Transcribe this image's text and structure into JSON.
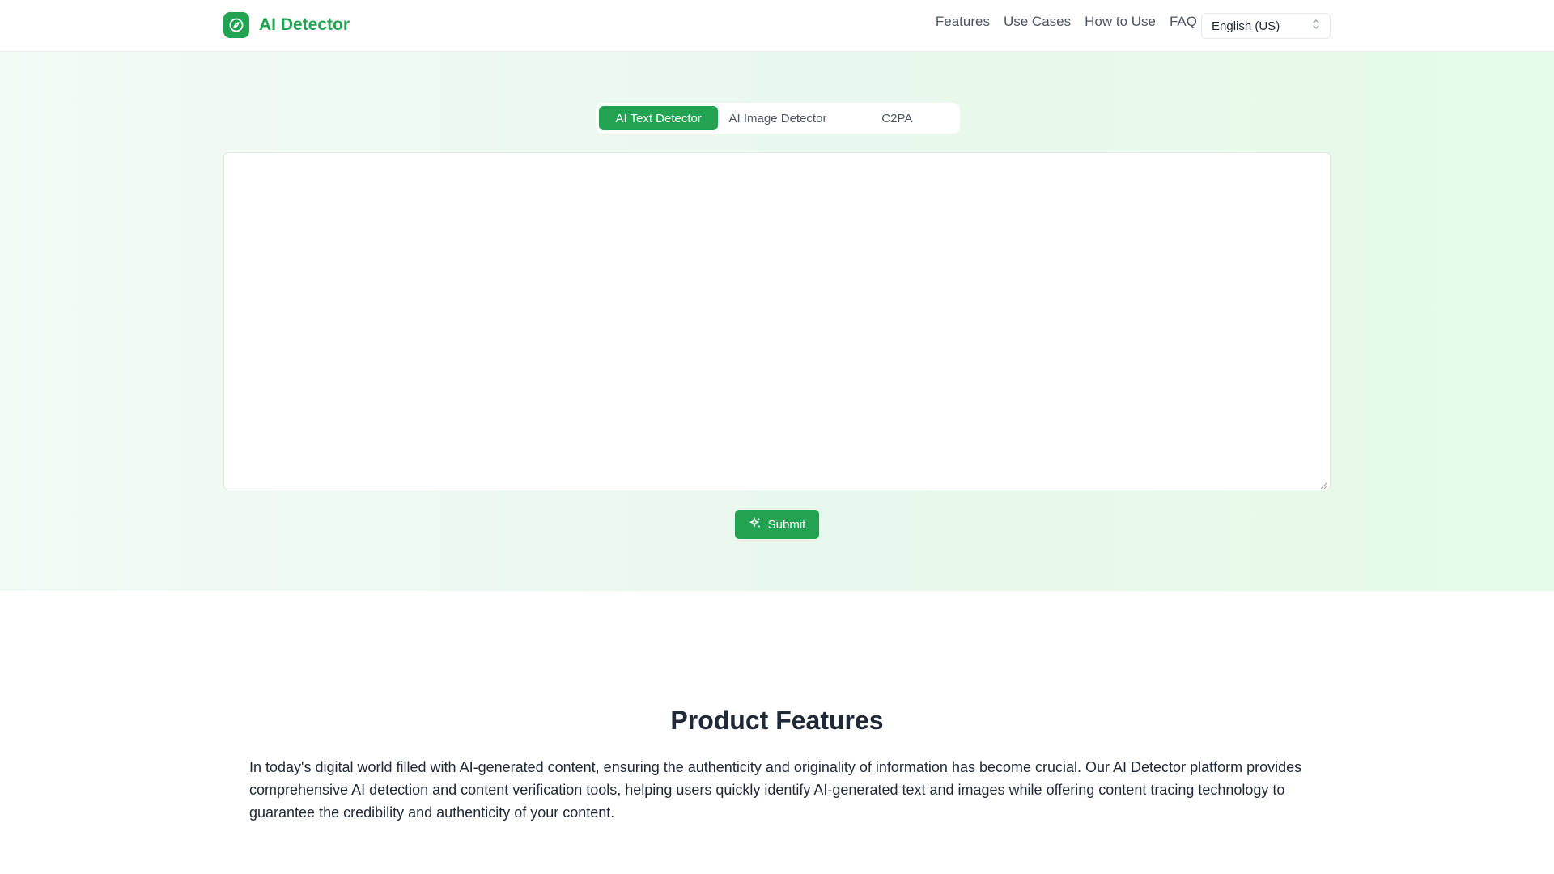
{
  "header": {
    "brand_name": "AI Detector",
    "brand_icon": "compass-icon",
    "nav": [
      {
        "label": "Features"
      },
      {
        "label": "Use Cases"
      },
      {
        "label": "How to Use"
      },
      {
        "label": "FAQ"
      }
    ],
    "language": {
      "selected": "English (US)",
      "icon": "chevron-up-down-icon"
    }
  },
  "hero": {
    "tabs": [
      {
        "label": "AI Text Detector",
        "active": true
      },
      {
        "label": "AI Image Detector",
        "active": false
      },
      {
        "label": "C2PA",
        "active": false
      }
    ],
    "textarea": {
      "value": "",
      "placeholder": ""
    },
    "submit_label": "Submit",
    "submit_icon": "sparkles-icon"
  },
  "features": {
    "title": "Product Features",
    "description": "In today's digital world filled with AI-generated content, ensuring the authenticity and originality of information has become crucial. Our AI Detector platform provides comprehensive AI detection and content verification tools, helping users quickly identify AI-generated text and images while offering content tracing technology to guarantee the credibility and authenticity of your content."
  },
  "colors": {
    "accent": "#22a352",
    "hero_bg_start": "#f3fbf5",
    "hero_bg_end": "#e6fbe9",
    "text_primary": "#1f2937",
    "text_secondary": "#4b5563"
  }
}
